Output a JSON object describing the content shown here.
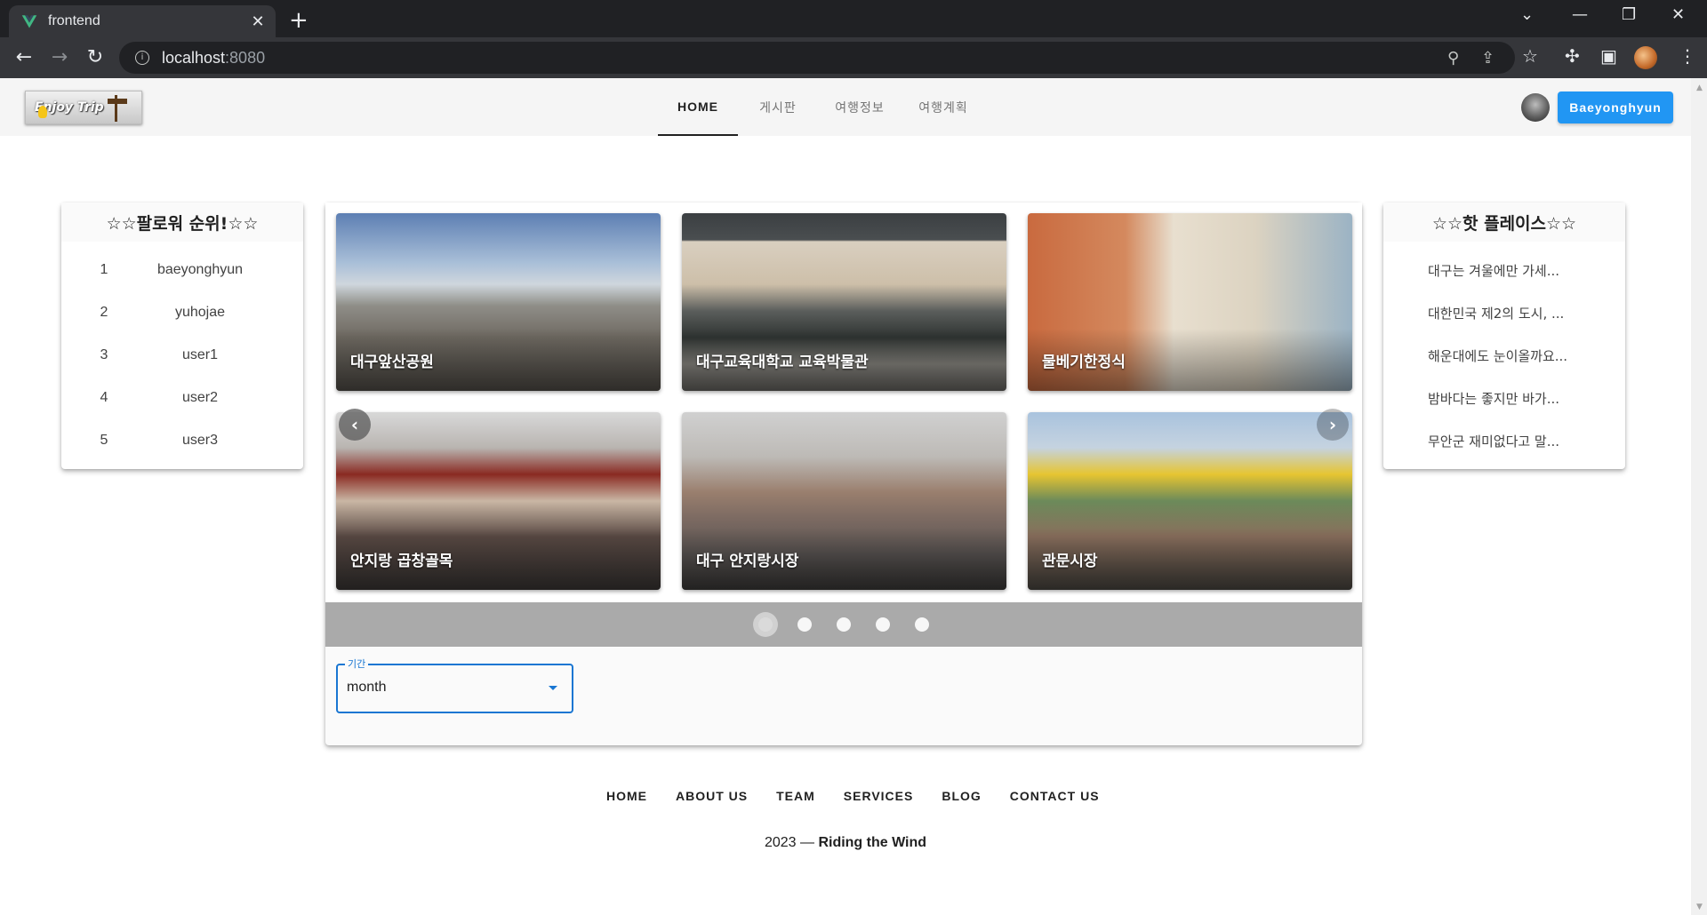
{
  "browser": {
    "tab_title": "frontend",
    "url_host": "localhost",
    "url_port": ":8080"
  },
  "header": {
    "logo_text": "Enjoy Trip",
    "nav": [
      "HOME",
      "게시판",
      "여행정보",
      "여행계획"
    ],
    "active_nav": "HOME",
    "user_button": "Baeyonghyun"
  },
  "follower_ranking": {
    "title": "☆☆팔로워 순위!☆☆",
    "rows": [
      {
        "rank": "1",
        "name": "baeyonghyun"
      },
      {
        "rank": "2",
        "name": "yuhojae"
      },
      {
        "rank": "3",
        "name": "user1"
      },
      {
        "rank": "4",
        "name": "user2"
      },
      {
        "rank": "5",
        "name": "user3"
      }
    ]
  },
  "hot_places": {
    "title": "☆☆핫 플레이스☆☆",
    "items": [
      "대구는 겨울에만 가세...",
      "대한민국 제2의 도시, ...",
      "해운대에도 눈이올까요...",
      "밤바다는 좋지만 바가...",
      "무안군 재미없다고 말..."
    ]
  },
  "carousel": {
    "slides": [
      "대구앞산공원",
      "대구교육대학교 교육박물관",
      "물베기한정식",
      "안지랑 곱창골목",
      "대구 안지랑시장",
      "관문시장"
    ],
    "dot_count": 5,
    "active_dot": 0
  },
  "period_select": {
    "label": "기간",
    "value": "month"
  },
  "footer": {
    "links": [
      "HOME",
      "ABOUT US",
      "TEAM",
      "SERVICES",
      "BLOG",
      "CONTACT US"
    ],
    "year": "2023 — ",
    "brand": "Riding the Wind"
  },
  "colors": {
    "primary": "#2196f3",
    "select_focus": "#1976d2",
    "dots_bar": "#aaaaaa"
  }
}
